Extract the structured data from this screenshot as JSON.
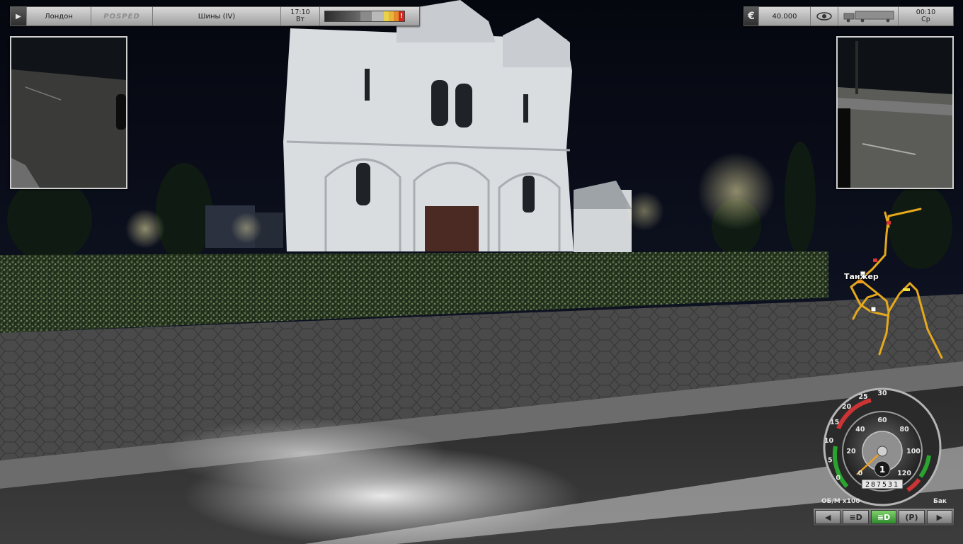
{
  "top_left_bar": {
    "origin": "Лондон",
    "company_logo_text": "POSPED",
    "cargo": "Шины (IV)",
    "time": "17:10",
    "day": "Вт",
    "damage_indicator": "!"
  },
  "top_right_bar": {
    "money": "40.000",
    "currency_icon": "€",
    "time": "00:10",
    "day": "Ср"
  },
  "minimap": {
    "city_label": "Танжер"
  },
  "speedometer": {
    "rpm_ticks": [
      "0",
      "5",
      "10",
      "15",
      "20",
      "25",
      "30"
    ],
    "speed_ticks": [
      "0",
      "20",
      "40",
      "60",
      "80",
      "100",
      "120"
    ],
    "gear": "1",
    "odometer": "287531",
    "rpm_label": "ОБ/М x100",
    "fuel_label": "Бак"
  },
  "controls": {
    "left_signal": "◀",
    "low_beam": "≡D",
    "high_beam": "≡D",
    "parking": "(P)",
    "right_signal": "▶"
  }
}
